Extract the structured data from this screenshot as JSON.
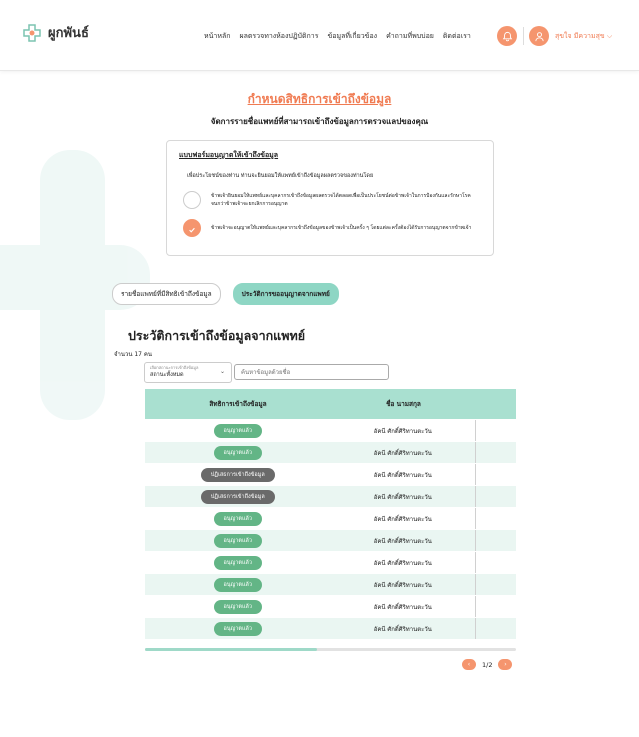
{
  "header": {
    "logo_text": "ผูกพันธ์",
    "nav": [
      "หน้าหลัก",
      "ผลตรวจทางห้องปฏิบัติการ",
      "ข้อมูลที่เกี่ยวข้อง",
      "คำถามที่พบบ่อย",
      "ติดต่อเรา"
    ],
    "user_name": "สุขใจ มีความสุข ⌵"
  },
  "page": {
    "title": "กำหนดสิทธิการเข้าถึงข้อมูล",
    "subtitle": "จัดการรายชื่อแพทย์ที่สามารถเข้าถึงข้อมูลการตรวจแลปของคุณ"
  },
  "consent": {
    "heading": "แบบฟอร์มอนุญาตให้เข้าถึงข้อมูล",
    "desc": "เพื่อประโยชน์ของท่าน ท่านจะยินยอมให้แพทย์เข้าถึงข้อมูลผลตรวจของท่านโดย",
    "option1": "ข้าพเจ้ายินยอมให้แพทย์และบุคลากรเข้าถึงข้อมูลผลตรวจได้ตลอดเพื่อเป็นประโยชน์ต่อข้าพเจ้าในการป้องกันและรักษาโรค จนกว่าข้าพเจ้าจะยกเลิกการอนุญาต",
    "option2": "ข้าพเจ้าจะอนุญาตให้แพทย์และบุคลากรเข้าถึงข้อมูลของข้าพเจ้าเป็นครั้ง ๆ โดยแต่ละครั้งต้องได้รับการอนุญาตจากข้าพเจ้า",
    "selected": 2
  },
  "tabs": [
    "รายชื่อแพทย์ที่มีสิทธิเข้าถึงข้อมูล",
    "ประวัติการขออนุญาตจากแพทย์"
  ],
  "section": {
    "title": "ประวัติการเข้าถึงข้อมูลจากแพทย์",
    "count": "จำนวน 17 คน"
  },
  "filter": {
    "label": "เลือกสถานะการเข้าถึงข้อมูล",
    "value": "สถานะทั้งหมด",
    "search_placeholder": "ค้นหาข้อมูลด้วยชื่อ"
  },
  "table": {
    "headers": [
      "สิทธิการเข้าถึงข้อมูล",
      "ชื่อ นามสกุล"
    ],
    "rows": [
      {
        "status": "อนุญาตแล้ว",
        "type": "ok",
        "name": "อัคนี ศักดิ์ศิริทานตะวัน"
      },
      {
        "status": "อนุญาตแล้ว",
        "type": "ok",
        "name": "อัคนี ศักดิ์ศิริทานตะวัน"
      },
      {
        "status": "ปฏิเสธการเข้าถึงข้อมูล",
        "type": "no",
        "name": "อัคนี ศักดิ์ศิริทานตะวัน"
      },
      {
        "status": "ปฏิเสธการเข้าถึงข้อมูล",
        "type": "no",
        "name": "อัคนี ศักดิ์ศิริทานตะวัน"
      },
      {
        "status": "อนุญาตแล้ว",
        "type": "ok",
        "name": "อัคนี ศักดิ์ศิริทานตะวัน"
      },
      {
        "status": "อนุญาตแล้ว",
        "type": "ok",
        "name": "อัคนี ศักดิ์ศิริทานตะวัน"
      },
      {
        "status": "อนุญาตแล้ว",
        "type": "ok",
        "name": "อัคนี ศักดิ์ศิริทานตะวัน"
      },
      {
        "status": "อนุญาตแล้ว",
        "type": "ok",
        "name": "อัคนี ศักดิ์ศิริทานตะวัน"
      },
      {
        "status": "อนุญาตแล้ว",
        "type": "ok",
        "name": "อัคนี ศักดิ์ศิริทานตะวัน"
      },
      {
        "status": "อนุญาตแล้ว",
        "type": "ok",
        "name": "อัคนี ศักดิ์ศิริทานตะวัน"
      }
    ]
  },
  "pager": {
    "text": "1/2"
  },
  "colors": {
    "accent": "#f07b52",
    "teal": "#a9e0d0",
    "approved": "#63b586",
    "denied": "#6a6a6a"
  },
  "icons": {
    "bell": "bell-icon",
    "user": "user-icon",
    "logo": "logo-icon",
    "check": "check-icon"
  }
}
